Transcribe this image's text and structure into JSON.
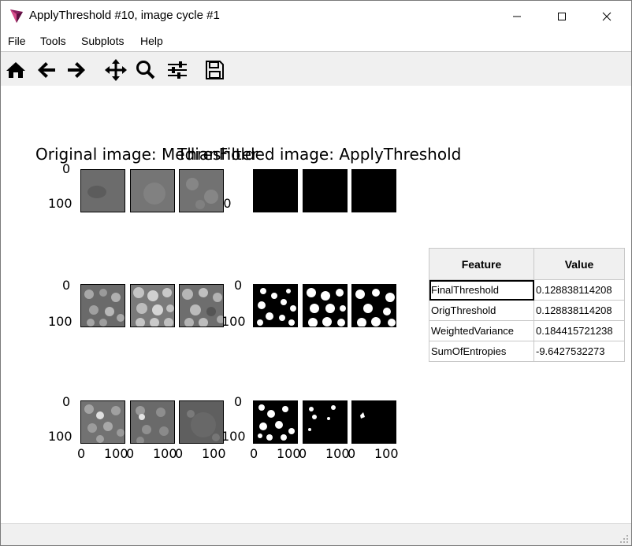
{
  "window": {
    "title": "ApplyThreshold #10, image cycle #1"
  },
  "menu": {
    "items": [
      "File",
      "Tools",
      "Subplots",
      "Help"
    ]
  },
  "toolbar": {
    "icons": [
      "home-icon",
      "back-icon",
      "forward-icon",
      "pan-icon",
      "zoom-icon",
      "configure-icon",
      "save-icon"
    ]
  },
  "plots": {
    "title_left": "Original image: MedianFilter",
    "title_right": "Thresholded image: ApplyThreshold",
    "y_tick_0": "0",
    "y_tick_100": "100",
    "x_tick_0": "0",
    "x_tick_100": "100"
  },
  "table": {
    "headers": [
      "Feature",
      "Value"
    ],
    "rows": [
      [
        "FinalThreshold",
        "0.128838114208"
      ],
      [
        "OrigThreshold",
        "0.128838114208"
      ],
      [
        "WeightedVariance",
        "0.184415721238"
      ],
      [
        "SumOfEntropies",
        "-9.6427532273"
      ]
    ]
  }
}
